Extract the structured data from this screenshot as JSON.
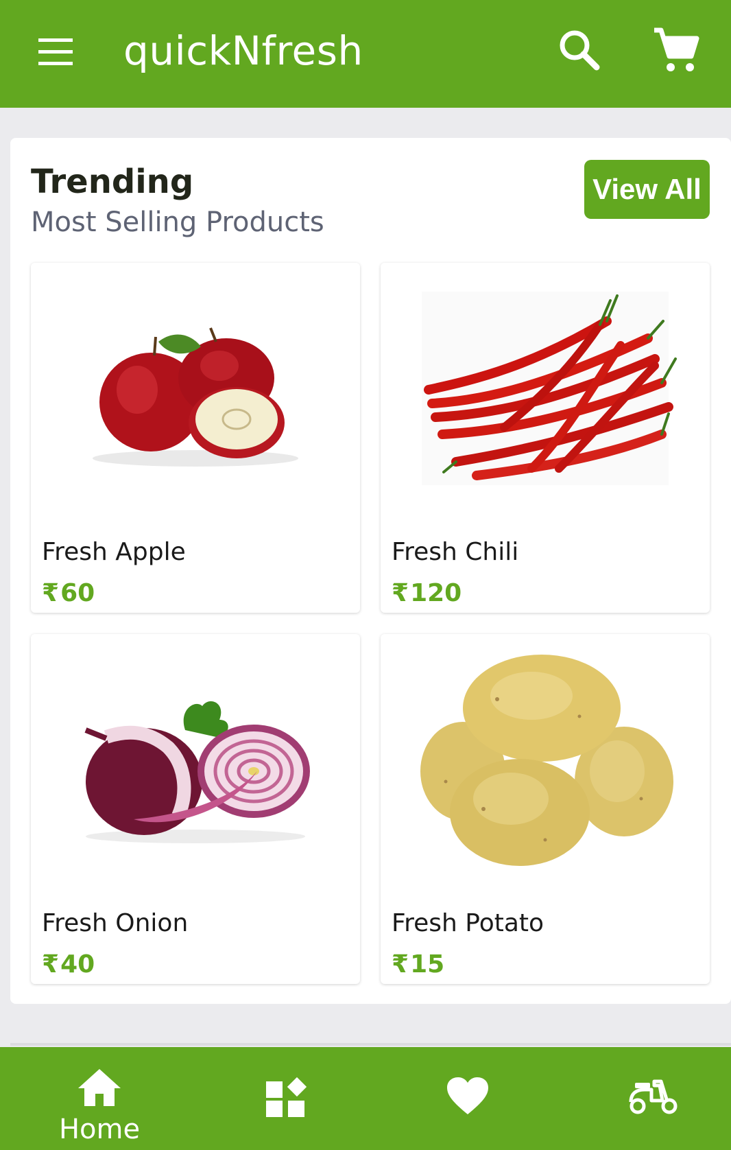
{
  "app": {
    "title": "quickNfresh",
    "brand_color": "#62a820",
    "icons": [
      "menu-icon",
      "search-icon",
      "cart-icon"
    ]
  },
  "trending": {
    "heading": "Trending",
    "subheading": "Most Selling Products",
    "view_all_label": "View All",
    "products": [
      {
        "name": "Fresh Apple",
        "currency": "₹",
        "price": "60",
        "image": "apple"
      },
      {
        "name": "Fresh Chili",
        "currency": "₹",
        "price": "120",
        "image": "chili"
      },
      {
        "name": "Fresh Onion",
        "currency": "₹",
        "price": "40",
        "image": "onion"
      },
      {
        "name": "Fresh Potato",
        "currency": "₹",
        "price": "15",
        "image": "potato"
      }
    ]
  },
  "bottom_nav": {
    "items": [
      {
        "label": "Home",
        "icon": "home-icon",
        "active": true
      },
      {
        "label": "",
        "icon": "categories-icon",
        "active": false
      },
      {
        "label": "",
        "icon": "heart-icon",
        "active": false
      },
      {
        "label": "",
        "icon": "delivery-scooter-icon",
        "active": false
      }
    ]
  }
}
